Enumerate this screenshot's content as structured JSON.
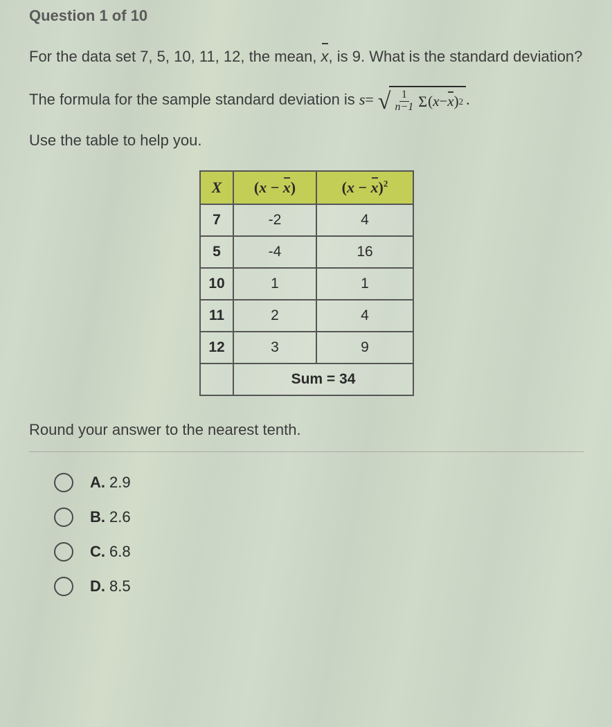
{
  "header": "Question 1 of 10",
  "prompt_part1": "For the data set 7, 5, 10, 11, 12, the mean, ",
  "prompt_xbar": "x",
  "prompt_part2": ", is 9. What is the standard deviation?",
  "formula_intro": "The formula for the sample standard deviation is ",
  "formula_lhs": "s",
  "formula_equals": " = ",
  "frac_num": "1",
  "frac_den": "n−1",
  "sigma": "Σ",
  "paren_open": "(",
  "var_x": "x",
  "minus": " − ",
  "paren_close": ")",
  "sq": "2",
  "period": ".",
  "help_line": "Use the table to help you.",
  "table": {
    "headers": {
      "x": "X"
    },
    "rows": [
      {
        "x": "7",
        "d": "-2",
        "s": "4"
      },
      {
        "x": "5",
        "d": "-4",
        "s": "16"
      },
      {
        "x": "10",
        "d": "1",
        "s": "1"
      },
      {
        "x": "11",
        "d": "2",
        "s": "4"
      },
      {
        "x": "12",
        "d": "3",
        "s": "9"
      }
    ],
    "sum_label": "Sum = 34"
  },
  "round_line": "Round your answer to the nearest tenth.",
  "options": [
    {
      "letter": "A.",
      "value": "2.9"
    },
    {
      "letter": "B.",
      "value": "2.6"
    },
    {
      "letter": "C.",
      "value": "6.8"
    },
    {
      "letter": "D.",
      "value": "8.5"
    }
  ]
}
